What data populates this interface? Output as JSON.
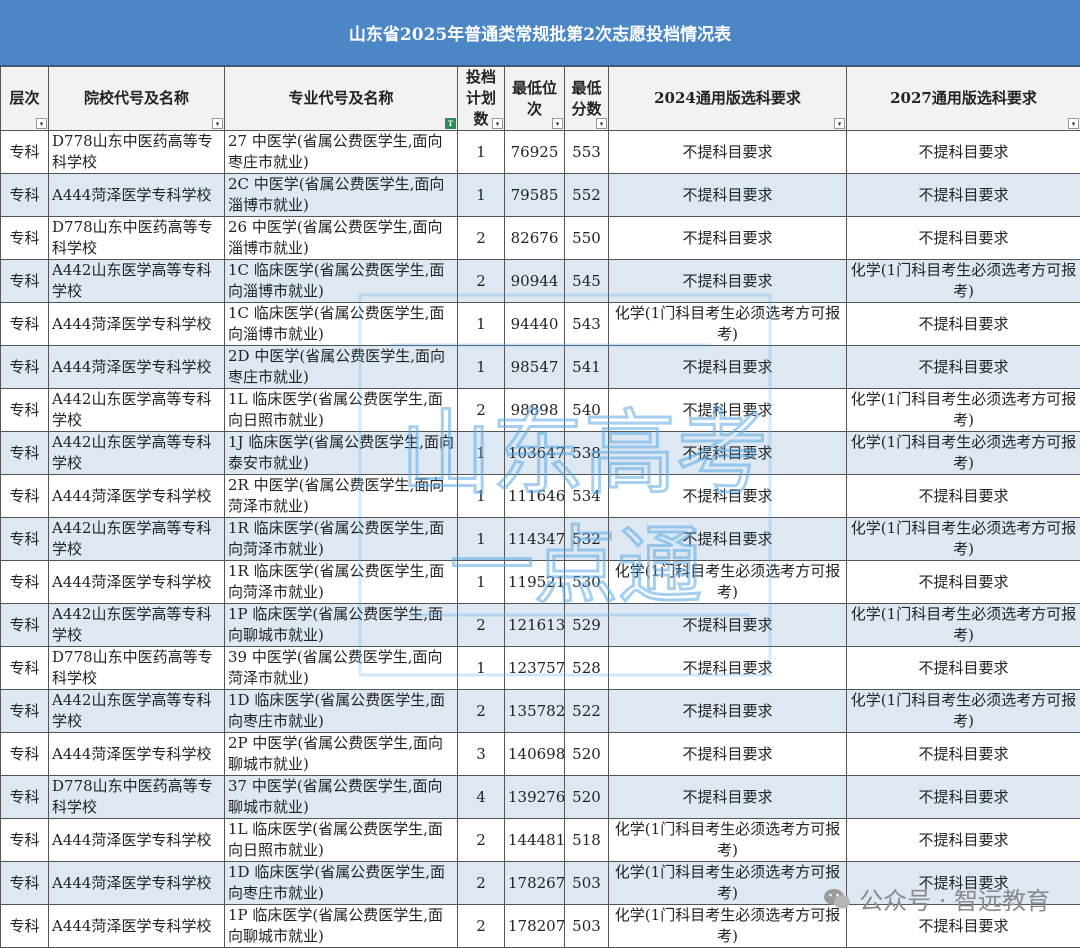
{
  "title": "山东省2025年普通类常规批第2次志愿投档情况表",
  "headers": [
    "层次",
    "院校代号及名称",
    "专业代号及名称",
    "投档计划数",
    "最低位次",
    "最低分数",
    "2024通用版选科要求",
    "2027通用版选科要求"
  ],
  "rows": [
    [
      "专科",
      "D778山东中医药高等专科学校",
      "27 中医学(省属公费医学生,面向枣庄市就业)",
      "1",
      "76925",
      "553",
      "不提科目要求",
      "不提科目要求"
    ],
    [
      "专科",
      "A444菏泽医学专科学校",
      "2C 中医学(省属公费医学生,面向淄博市就业)",
      "1",
      "79585",
      "552",
      "不提科目要求",
      "不提科目要求"
    ],
    [
      "专科",
      "D778山东中医药高等专科学校",
      "26 中医学(省属公费医学生,面向淄博市就业)",
      "2",
      "82676",
      "550",
      "不提科目要求",
      "不提科目要求"
    ],
    [
      "专科",
      "A442山东医学高等专科学校",
      "1C 临床医学(省属公费医学生,面向淄博市就业)",
      "2",
      "90944",
      "545",
      "不提科目要求",
      "化学(1门科目考生必须选考方可报考)"
    ],
    [
      "专科",
      "A444菏泽医学专科学校",
      "1C 临床医学(省属公费医学生,面向淄博市就业)",
      "1",
      "94440",
      "543",
      "化学(1门科目考生必须选考方可报考)",
      "不提科目要求"
    ],
    [
      "专科",
      "A444菏泽医学专科学校",
      "2D 中医学(省属公费医学生,面向枣庄市就业)",
      "1",
      "98547",
      "541",
      "不提科目要求",
      "不提科目要求"
    ],
    [
      "专科",
      "A442山东医学高等专科学校",
      "1L 临床医学(省属公费医学生,面向日照市就业)",
      "2",
      "98898",
      "540",
      "不提科目要求",
      "化学(1门科目考生必须选考方可报考)"
    ],
    [
      "专科",
      "A442山东医学高等专科学校",
      "1J 临床医学(省属公费医学生,面向泰安市就业)",
      "1",
      "103647",
      "538",
      "不提科目要求",
      "化学(1门科目考生必须选考方可报考)"
    ],
    [
      "专科",
      "A444菏泽医学专科学校",
      "2R 中医学(省属公费医学生,面向菏泽市就业)",
      "1",
      "111646",
      "534",
      "不提科目要求",
      "不提科目要求"
    ],
    [
      "专科",
      "A442山东医学高等专科学校",
      "1R 临床医学(省属公费医学生,面向菏泽市就业)",
      "1",
      "114347",
      "532",
      "不提科目要求",
      "化学(1门科目考生必须选考方可报考)"
    ],
    [
      "专科",
      "A444菏泽医学专科学校",
      "1R 临床医学(省属公费医学生,面向菏泽市就业)",
      "1",
      "119521",
      "530",
      "化学(1门科目考生必须选考方可报考)",
      "不提科目要求"
    ],
    [
      "专科",
      "A442山东医学高等专科学校",
      "1P 临床医学(省属公费医学生,面向聊城市就业)",
      "2",
      "121613",
      "529",
      "不提科目要求",
      "化学(1门科目考生必须选考方可报考)"
    ],
    [
      "专科",
      "D778山东中医药高等专科学校",
      "39 中医学(省属公费医学生,面向菏泽市就业)",
      "1",
      "123757",
      "528",
      "不提科目要求",
      "不提科目要求"
    ],
    [
      "专科",
      "A442山东医学高等专科学校",
      "1D 临床医学(省属公费医学生,面向枣庄市就业)",
      "2",
      "135782",
      "522",
      "不提科目要求",
      "化学(1门科目考生必须选考方可报考)"
    ],
    [
      "专科",
      "A444菏泽医学专科学校",
      "2P 中医学(省属公费医学生,面向聊城市就业)",
      "3",
      "140698",
      "520",
      "不提科目要求",
      "不提科目要求"
    ],
    [
      "专科",
      "D778山东中医药高等专科学校",
      "37 中医学(省属公费医学生,面向聊城市就业)",
      "4",
      "139276",
      "520",
      "不提科目要求",
      "不提科目要求"
    ],
    [
      "专科",
      "A444菏泽医学专科学校",
      "1L 临床医学(省属公费医学生,面向日照市就业)",
      "2",
      "144481",
      "518",
      "化学(1门科目考生必须选考方可报考)",
      "不提科目要求"
    ],
    [
      "专科",
      "A444菏泽医学专科学校",
      "1D 临床医学(省属公费医学生,面向枣庄市就业)",
      "2",
      "178267",
      "503",
      "化学(1门科目考生必须选考方可报考)",
      "不提科目要求"
    ],
    [
      "专科",
      "A444菏泽医学专科学校",
      "1P 临床医学(省属公费医学生,面向聊城市就业)",
      "2",
      "178207",
      "503",
      "化学(1门科目考生必须选考方可报考)",
      "不提科目要求"
    ]
  ],
  "watermark": {
    "text_line1": "山东高考",
    "text_line2": "一点通",
    "color": "#5aa9e6"
  },
  "wechat_tag": {
    "icon": "wechat-icon",
    "text": "公众号 · 智远教育"
  }
}
